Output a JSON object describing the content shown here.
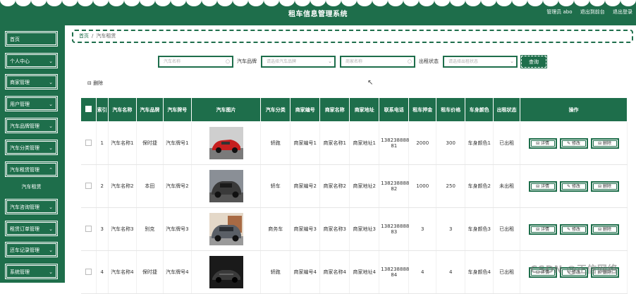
{
  "header": {
    "title": "租车信息管理系统",
    "user_label": "管理员 abo",
    "to_front": "退出到前台",
    "logout": "退出登录"
  },
  "sidebar": {
    "items": [
      {
        "label": "首页",
        "chevron": ""
      },
      {
        "label": "个人中心",
        "chevron": "⌄"
      },
      {
        "label": "商家管理",
        "chevron": "⌄"
      },
      {
        "label": "用户管理",
        "chevron": "⌄"
      },
      {
        "label": "汽车品牌管理",
        "chevron": "⌄"
      },
      {
        "label": "汽车分类管理",
        "chevron": "⌄"
      },
      {
        "label": "汽车租赁管理",
        "chevron": "⌃"
      },
      {
        "label": "汽车咨询管理",
        "chevron": "⌄"
      },
      {
        "label": "租赁订单管理",
        "chevron": "⌄"
      },
      {
        "label": "还车记录管理",
        "chevron": "⌄"
      },
      {
        "label": "系统管理",
        "chevron": "⌄"
      }
    ],
    "sub_item": "汽车租赁"
  },
  "breadcrumb": {
    "home": "首页",
    "sep": "/",
    "current": "汽车租赁"
  },
  "search": {
    "car_name_placeholder": "汽车名称",
    "brand_label": "汽车品牌",
    "brand_placeholder": "请选择汽车品牌",
    "merchant_placeholder": "商家名称",
    "status_label": "出租状态",
    "status_placeholder": "请选择出租状态",
    "query_button": "查询"
  },
  "toolbar": {
    "delete_label": "⊟ 删除"
  },
  "table": {
    "headers": [
      "",
      "索引",
      "汽车名称",
      "汽车品牌",
      "汽车牌号",
      "汽车图片",
      "汽车分类",
      "商家编号",
      "商家名称",
      "商家地址",
      "联系电话",
      "租车押金",
      "租车价格",
      "车身颜色",
      "出租状态",
      "操作"
    ],
    "rows": [
      {
        "idx": "1",
        "name": "汽车名称1",
        "brand": "保时捷",
        "plate": "汽车牌号1",
        "category": "轿跑",
        "merchant_no": "商家编号1",
        "merchant_name": "商家名称1",
        "address": "商家地址1",
        "phone": "138238888 81",
        "deposit": "2000",
        "price": "300",
        "color": "车身颜色1",
        "status": "已出租",
        "img_color": "#c62020"
      },
      {
        "idx": "2",
        "name": "汽车名称2",
        "brand": "本田",
        "plate": "汽车牌号2",
        "category": "轿车",
        "merchant_no": "商家编号2",
        "merchant_name": "商家名称2",
        "address": "商家地址2",
        "phone": "138238888 82",
        "deposit": "1000",
        "price": "250",
        "color": "车身颜色2",
        "status": "未出租",
        "img_color": "#3a3a3a"
      },
      {
        "idx": "3",
        "name": "汽车名称3",
        "brand": "别克",
        "plate": "汽车牌号3",
        "category": "商务车",
        "merchant_no": "商家编号3",
        "merchant_name": "商家名称3",
        "address": "商家地址3",
        "phone": "138238888 83",
        "deposit": "3",
        "price": "3",
        "color": "车身颜色3",
        "status": "已出租",
        "img_color": "#5a5f66"
      },
      {
        "idx": "4",
        "name": "汽车名称4",
        "brand": "保时捷",
        "plate": "汽车牌号4",
        "category": "轿跑",
        "merchant_no": "商家编号4",
        "merchant_name": "商家名称4",
        "address": "商家地址4",
        "phone": "138238888 84",
        "deposit": "4",
        "price": "4",
        "color": "车身颜色4",
        "status": "已出租",
        "img_color": "#222222"
      }
    ],
    "actions": {
      "detail": "⊟ 详情",
      "edit": "✎ 修改",
      "delete": "⊟ 删除"
    }
  },
  "watermark": "CSDN @正信网络",
  "colors": {
    "primary": "#1e6e4b",
    "white": "#ffffff"
  }
}
